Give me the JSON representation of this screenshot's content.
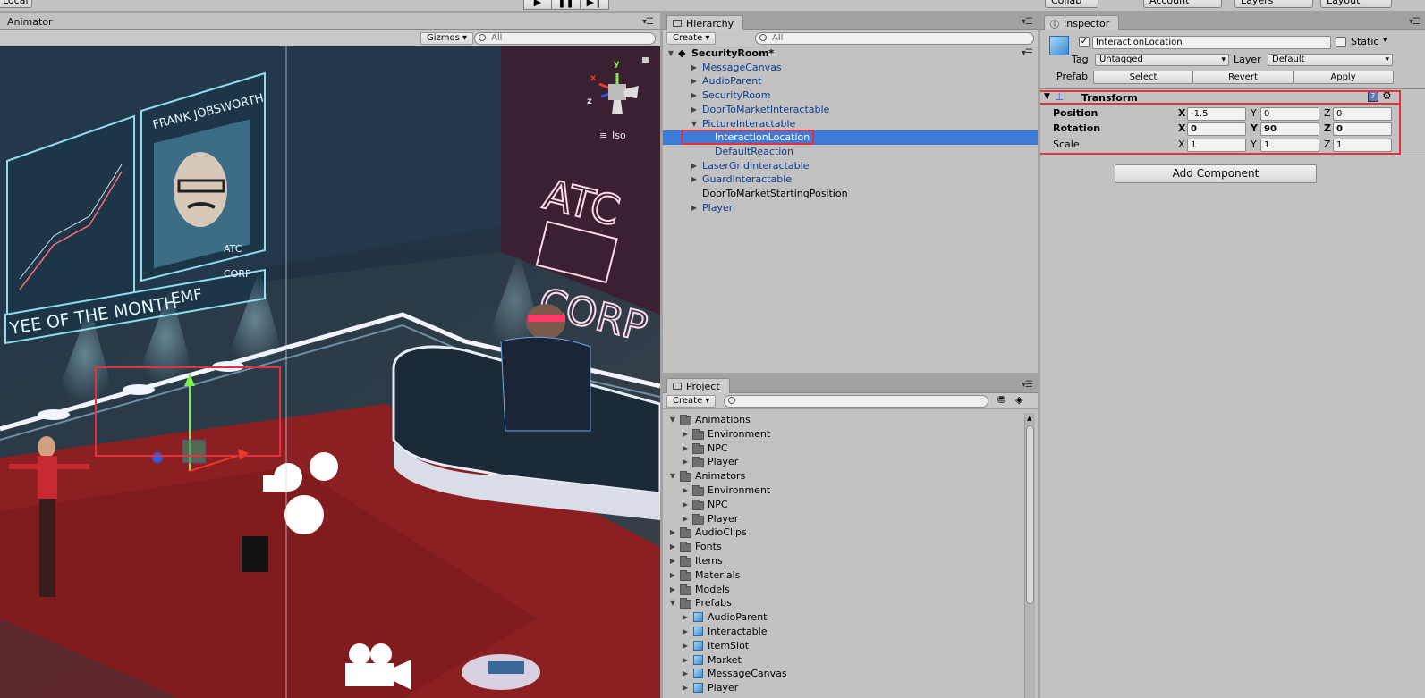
{
  "toolbar": {
    "local_label": "Local",
    "collab_label": "Collab",
    "account_label": "Account",
    "layers_label": "Layers",
    "layout_label": "Layout"
  },
  "scene": {
    "tab_label": "Animator",
    "gizmos_label": "Gizmos",
    "search_placeholder": "All",
    "iso_label": "Iso",
    "axis_x": "x",
    "axis_y": "y",
    "axis_z": "z",
    "portrait_name": "FRANK JOBSWORTH",
    "board_caption": "YEE OF THE MONTH",
    "board_initials": "EMF",
    "corp_top": "ATC",
    "corp_bottom": "CORP",
    "small_sign_top": "ATC",
    "small_sign_bottom": "CORP"
  },
  "hierarchy": {
    "tab_label": "Hierarchy",
    "create_label": "Create",
    "search_placeholder": "All",
    "scene_name": "SecurityRoom*",
    "items": [
      {
        "label": "MessageCanvas",
        "indent": 1,
        "arrow": "▶",
        "type": "prefab"
      },
      {
        "label": "AudioParent",
        "indent": 1,
        "arrow": "▶",
        "type": "prefab"
      },
      {
        "label": "SecurityRoom",
        "indent": 1,
        "arrow": "▶",
        "type": "prefab"
      },
      {
        "label": "DoorToMarketInteractable",
        "indent": 1,
        "arrow": "▶",
        "type": "prefab"
      },
      {
        "label": "PictureInteractable",
        "indent": 1,
        "arrow": "▼",
        "type": "prefab"
      },
      {
        "label": "InteractionLocation",
        "indent": 2,
        "arrow": "",
        "type": "selected"
      },
      {
        "label": "DefaultReaction",
        "indent": 2,
        "arrow": "",
        "type": "prefab"
      },
      {
        "label": "LaserGridInteractable",
        "indent": 1,
        "arrow": "▶",
        "type": "prefab"
      },
      {
        "label": "GuardInteractable",
        "indent": 1,
        "arrow": "▶",
        "type": "prefab"
      },
      {
        "label": "DoorToMarketStartingPosition",
        "indent": 1,
        "arrow": "",
        "type": "plain"
      },
      {
        "label": "Player",
        "indent": 1,
        "arrow": "▶",
        "type": "prefab"
      }
    ]
  },
  "project": {
    "tab_label": "Project",
    "create_label": "Create",
    "items": [
      {
        "label": "Animations",
        "indent": 0,
        "arrow": "▼",
        "icon": "folder"
      },
      {
        "label": "Environment",
        "indent": 1,
        "arrow": "▶",
        "icon": "folder"
      },
      {
        "label": "NPC",
        "indent": 1,
        "arrow": "▶",
        "icon": "folder"
      },
      {
        "label": "Player",
        "indent": 1,
        "arrow": "▶",
        "icon": "folder"
      },
      {
        "label": "Animators",
        "indent": 0,
        "arrow": "▼",
        "icon": "folder"
      },
      {
        "label": "Environment",
        "indent": 1,
        "arrow": "▶",
        "icon": "folder"
      },
      {
        "label": "NPC",
        "indent": 1,
        "arrow": "▶",
        "icon": "folder"
      },
      {
        "label": "Player",
        "indent": 1,
        "arrow": "▶",
        "icon": "folder"
      },
      {
        "label": "AudioClips",
        "indent": 0,
        "arrow": "▶",
        "icon": "folder"
      },
      {
        "label": "Fonts",
        "indent": 0,
        "arrow": "▶",
        "icon": "folder"
      },
      {
        "label": "Items",
        "indent": 0,
        "arrow": "▶",
        "icon": "folder"
      },
      {
        "label": "Materials",
        "indent": 0,
        "arrow": "▶",
        "icon": "folder"
      },
      {
        "label": "Models",
        "indent": 0,
        "arrow": "▶",
        "icon": "folder"
      },
      {
        "label": "Prefabs",
        "indent": 0,
        "arrow": "▼",
        "icon": "folder"
      },
      {
        "label": "AudioParent",
        "indent": 1,
        "arrow": "▶",
        "icon": "cube"
      },
      {
        "label": "Interactable",
        "indent": 1,
        "arrow": "▶",
        "icon": "cube"
      },
      {
        "label": "ItemSlot",
        "indent": 1,
        "arrow": "▶",
        "icon": "cube"
      },
      {
        "label": "Market",
        "indent": 1,
        "arrow": "▶",
        "icon": "cube"
      },
      {
        "label": "MessageCanvas",
        "indent": 1,
        "arrow": "▶",
        "icon": "cube"
      },
      {
        "label": "Player",
        "indent": 1,
        "arrow": "▶",
        "icon": "cube"
      }
    ]
  },
  "inspector": {
    "tab_label": "Inspector",
    "object_name": "InteractionLocation",
    "static_label": "Static",
    "tag_label": "Tag",
    "tag_value": "Untagged",
    "layer_label": "Layer",
    "layer_value": "Default",
    "prefab_label": "Prefab",
    "select_label": "Select",
    "revert_label": "Revert",
    "apply_label": "Apply",
    "transform_label": "Transform",
    "position_label": "Position",
    "rotation_label": "Rotation",
    "scale_label": "Scale",
    "axis_x": "X",
    "axis_y": "Y",
    "axis_z": "Z",
    "position": {
      "x": "-1.5",
      "y": "0",
      "z": "0"
    },
    "rotation": {
      "x": "0",
      "y": "90",
      "z": "0"
    },
    "scale": {
      "x": "1",
      "y": "1",
      "z": "1"
    },
    "add_component_label": "Add Component"
  }
}
